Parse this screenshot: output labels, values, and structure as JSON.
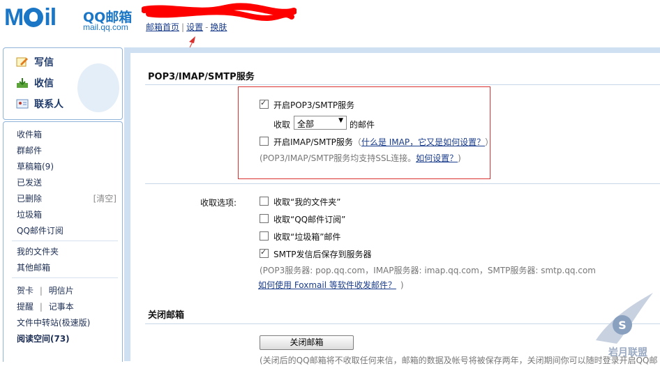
{
  "header": {
    "logo_mark": "MOil",
    "logo_brand": "QQ邮箱",
    "logo_url": "mail.qq.com",
    "links": [
      "邮箱首页",
      "设置",
      "换肤"
    ],
    "sep1": "|",
    "sep2": "-"
  },
  "sidebar": {
    "compose": "写信",
    "inbox": "收信",
    "contacts": "联系人",
    "folders": [
      "收件箱",
      "群邮件",
      "草稿箱(9)",
      "已发送",
      "已删除",
      "垃圾箱",
      "QQ邮件订阅"
    ],
    "clear_label": "[清空]",
    "my_folders": [
      "我的文件夹",
      "其他邮箱"
    ],
    "tools": {
      "greeting": "贺卡",
      "postcard": "明信片",
      "reminder": "提醒",
      "notes": "记事本",
      "transfer": "文件中转站(极速版)",
      "reading": "阅读空间(73)",
      "sep": "|"
    }
  },
  "pop": {
    "title": "POP3/IMAP/SMTP服务",
    "enable_pop": "开启POP3/SMTP服务",
    "enable_pop_checked": true,
    "receive_prefix": "收取",
    "receive_select_value": "全部",
    "receive_suffix": "的邮件",
    "enable_imap": "开启IMAP/SMTP服务",
    "enable_imap_checked": false,
    "imap_paren_open": "（",
    "imap_link": "什么是 IMAP，它又是如何设置？",
    "imap_paren_close": "）",
    "ssl_note": "(POP3/IMAP/SMTP服务均支持SSL连接。",
    "ssl_link": "如何设置？",
    "ssl_close": ")"
  },
  "receive_options": {
    "label": "收取选项:",
    "opts": [
      {
        "text": "收取“我的文件夹”",
        "checked": false
      },
      {
        "text": "收取“QQ邮件订阅”",
        "checked": false
      },
      {
        "text": "收取“垃圾箱”邮件",
        "checked": false
      },
      {
        "text": "SMTP发信后保存到服务器",
        "checked": true
      }
    ],
    "servers": "(POP3服务器: pop.qq.com，IMAP服务器: imap.qq.com，SMTP服务器: smtp.qq.com",
    "foxmail_link": "如何使用 Foxmail 等软件收发邮件？",
    "foxmail_close": ")"
  },
  "close_mailbox": {
    "title": "关闭邮箱",
    "button": "关闭邮箱",
    "note": "(关闭后的QQ邮箱将不收取任何来信，邮箱的数据及帐号将被保存两年，关闭期间你可以随时登录开启QQ邮"
  },
  "watermark": {
    "text": "岩月联盟"
  },
  "colors": {
    "brand": "#1b76c6",
    "highlight_box": "#d93030",
    "link": "#1a3c8c"
  }
}
